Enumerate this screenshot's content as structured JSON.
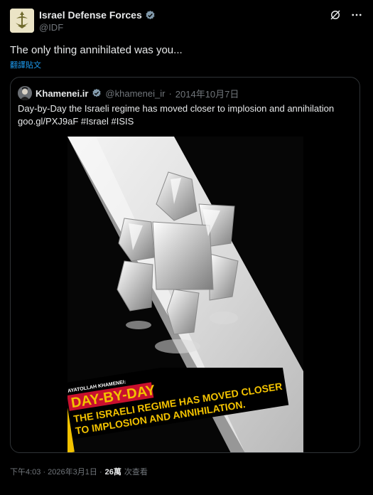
{
  "author": {
    "name": "Israel Defense Forces",
    "handle": "@IDF"
  },
  "tweet": {
    "text": "The only thing annihilated was you...",
    "translate_label": "翻譯貼文"
  },
  "quote": {
    "name": "Khamenei.ir",
    "handle": "@khamenei_ir",
    "separator": "·",
    "date": "2014年10月7日",
    "text_line1": "Day-by-Day the Israeli regime has moved closer to implosion and annihilation",
    "text_line2": "goo.gl/PXJ9aF #Israel #ISIS",
    "image": {
      "small_label": "AYATOLLAH KHAMENEI:",
      "headline": "DAY-BY-DAY",
      "line1": "THE ISRAELI REGIME HAS MOVED CLOSER",
      "line2": "TO IMPLOSION AND ANNIHILATION."
    }
  },
  "footer": {
    "time": "下午4:03 · 2026年3月1日 · ",
    "views_count": "26萬",
    "views_label": "次查看"
  },
  "colors": {
    "accent": "#1d9bf0",
    "banner_yellow": "#f2c200",
    "banner_red": "#c8102e"
  }
}
